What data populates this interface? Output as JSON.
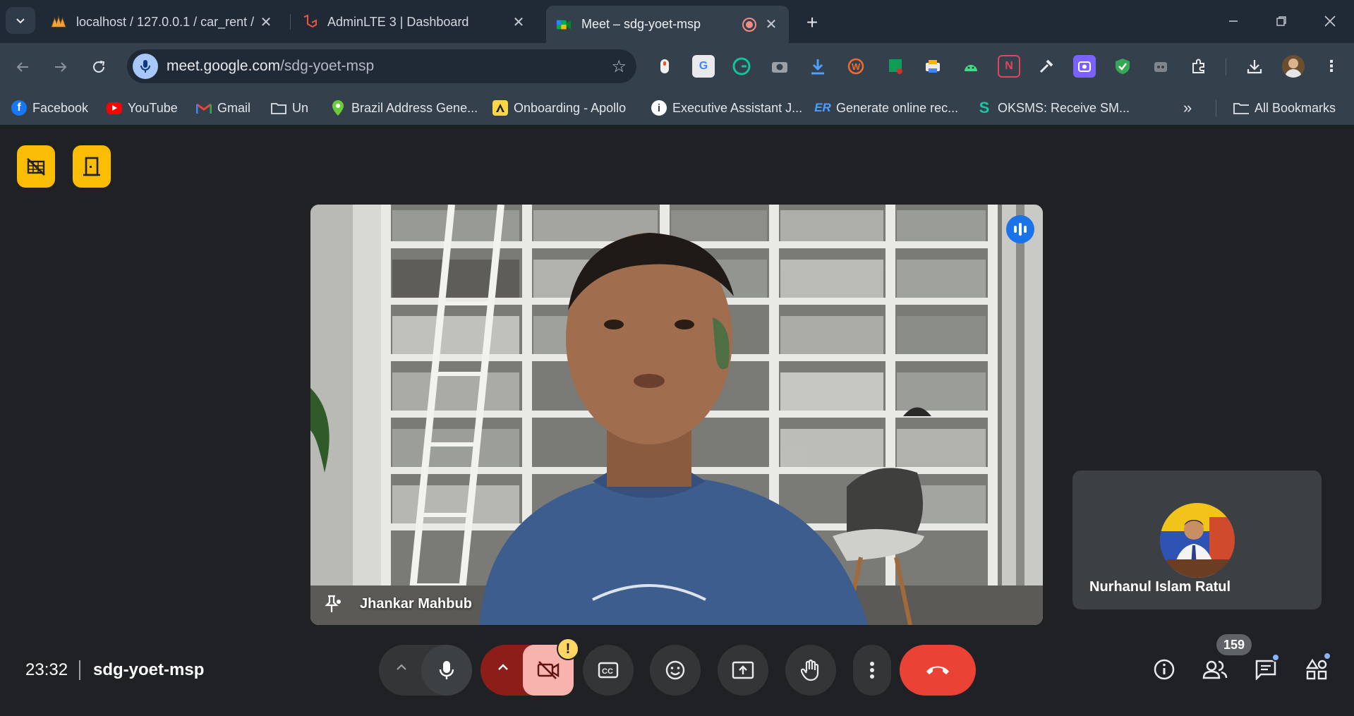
{
  "browser": {
    "tabs": [
      {
        "title": "localhost / 127.0.0.1 / car_rent /",
        "active": false
      },
      {
        "title": "AdminLTE 3 | Dashboard",
        "active": false
      },
      {
        "title": "Meet – sdg-yoet-msp",
        "active": true
      }
    ],
    "address": {
      "domain": "meet.google.com",
      "path": "/sdg-yoet-msp"
    },
    "bookmarks": [
      {
        "label": "Facebook",
        "icon": "facebook-icon"
      },
      {
        "label": "YouTube",
        "icon": "youtube-icon"
      },
      {
        "label": "Gmail",
        "icon": "gmail-icon"
      },
      {
        "label": "Un",
        "icon": "folder-icon"
      },
      {
        "label": "Brazil Address Gene...",
        "icon": "map-pin-icon"
      },
      {
        "label": "Onboarding - Apollo",
        "icon": "apollo-icon"
      },
      {
        "label": "Executive Assistant J...",
        "icon": "info-icon"
      },
      {
        "label": "Generate online rec...",
        "icon": "er-icon"
      },
      {
        "label": "OKSMS: Receive SM...",
        "icon": "sms-icon"
      }
    ],
    "all_bookmarks_label": "All Bookmarks"
  },
  "meet": {
    "main_participant": "Jhankar Mahbub",
    "side_participant": "Nurhanul Islam Ratul",
    "time": "23:32",
    "meeting_code": "sdg-yoet-msp",
    "participant_count": "159",
    "warning_badge": "!"
  },
  "colors": {
    "accent_yellow": "#fbbc04",
    "end_call_red": "#ea4335",
    "camera_off_red": "#8c1d18",
    "speaking_blue": "#1a73e8"
  }
}
